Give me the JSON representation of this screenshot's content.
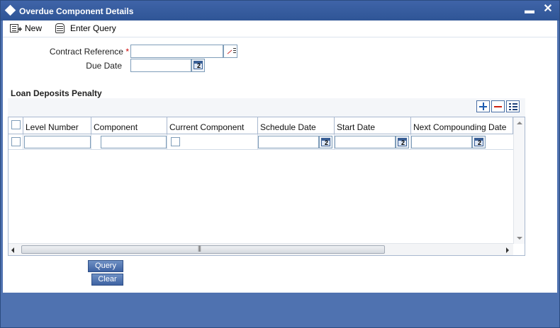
{
  "window": {
    "title": "Overdue Component Details",
    "minimize_glyph": "▬",
    "close_glyph": "✕"
  },
  "toolbar": {
    "new_label": "New",
    "enter_query_label": "Enter Query"
  },
  "form": {
    "contract_reference": {
      "label": "Contract Reference",
      "required_mark": "*",
      "value": ""
    },
    "due_date": {
      "label": "Due Date",
      "value": ""
    }
  },
  "section": {
    "title": "Loan Deposits Penalty"
  },
  "grid": {
    "columns": [
      "Level Number",
      "Component",
      "Current Component",
      "Schedule Date",
      "Start Date",
      "Next Compounding Date"
    ],
    "rows": [
      {
        "level_number": "",
        "component": "",
        "current_component": false,
        "schedule_date": "",
        "start_date": "",
        "next_compounding_date": ""
      }
    ]
  },
  "actions": {
    "query_label": "Query",
    "clear_label": "Clear"
  },
  "icons": {
    "new": "new-record-icon",
    "enter_query": "database-icon",
    "lov": "lov-list-icon",
    "calendar": "calendar-icon",
    "add_row": "plus-icon",
    "delete_row": "minus-icon",
    "single_view": "list-detail-icon"
  },
  "colors": {
    "titlebar": "#2f5596",
    "frame": "#4f72b0",
    "button": "#3e62a2",
    "required": "#cc0000"
  }
}
